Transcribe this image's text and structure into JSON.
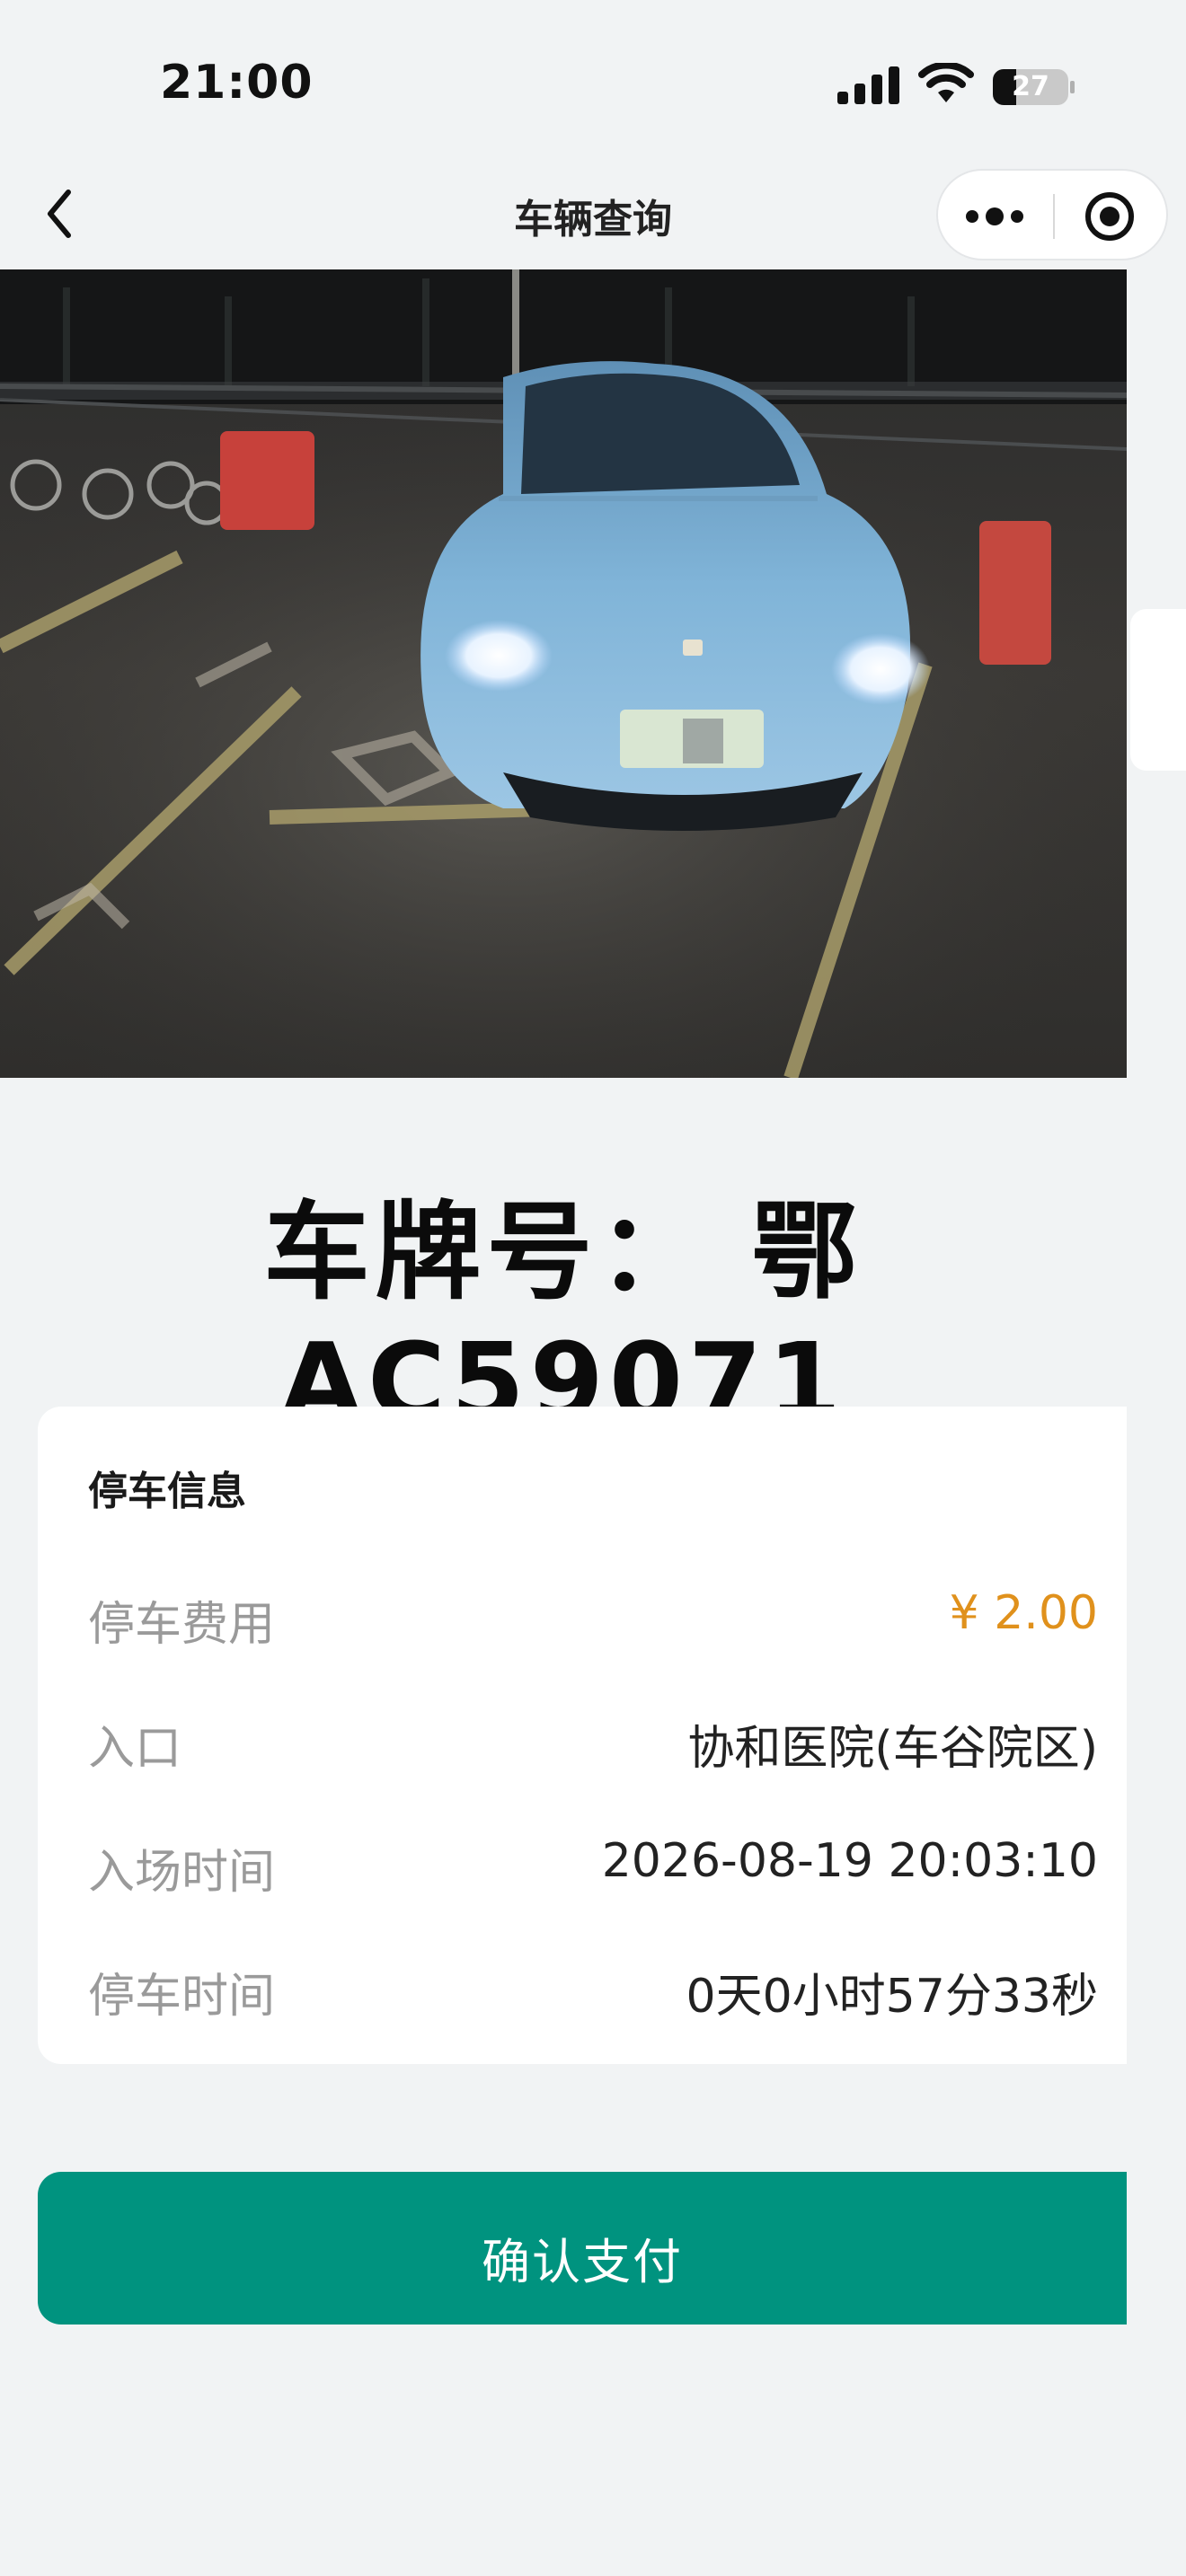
{
  "status_bar": {
    "time": "21:00",
    "battery": "27",
    "icons": [
      "signal-icon",
      "wifi-icon",
      "battery-icon"
    ]
  },
  "nav": {
    "title": "车辆查询",
    "icons": [
      "back-icon",
      "more-icon",
      "close-icon"
    ]
  },
  "plate": {
    "title": "车牌号： 鄂AC59071"
  },
  "parking_info": {
    "title": "停车信息",
    "rows": [
      {
        "label": "停车费用",
        "value": "¥ 2.00"
      },
      {
        "label": "入口",
        "value": "协和医院(车谷院区)"
      },
      {
        "label": "入场时间",
        "value": "2026-08-19 20:03:10"
      },
      {
        "label": "停车时间",
        "value": "0天0小时57分33秒"
      }
    ]
  },
  "actions": {
    "pay_label": "确认支付"
  },
  "colors": {
    "accent": "#00937f",
    "fee": "#e0911c",
    "background": "#f1f3f4"
  }
}
